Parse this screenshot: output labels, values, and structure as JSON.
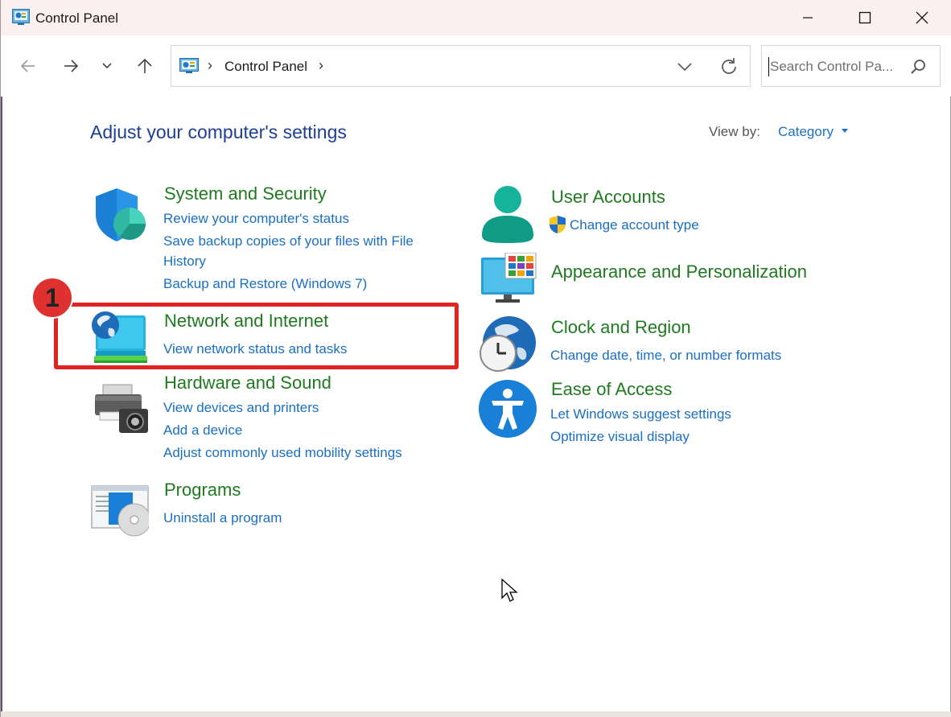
{
  "window": {
    "title": "Control Panel",
    "minimize_glyph": "—",
    "maximize_glyph": "☐",
    "close_glyph": "✕"
  },
  "navigation": {
    "back_icon": "arrow-left-icon",
    "forward_icon": "arrow-right-icon",
    "recent_icon": "chevron-down-icon",
    "up_icon": "arrow-up-icon"
  },
  "address_bar": {
    "separator": "›",
    "location": "Control Panel"
  },
  "search": {
    "placeholder": "Search Control Pa..."
  },
  "page": {
    "heading": "Adjust your computer's settings",
    "view_by_label": "View by:",
    "view_by_value": "Category"
  },
  "categories": {
    "system_security": {
      "title": "System and Security",
      "links": [
        "Review your computer's status",
        "Save backup copies of your files with File",
        "History",
        "Backup and Restore (Windows 7)"
      ]
    },
    "network_internet": {
      "title": "Network and Internet",
      "links": [
        "View network status and tasks"
      ]
    },
    "hardware_sound": {
      "title": "Hardware and Sound",
      "links": [
        "View devices and printers",
        "Add a device",
        "Adjust commonly used mobility settings"
      ]
    },
    "programs": {
      "title": "Programs",
      "links": [
        "Uninstall a program"
      ]
    },
    "user_accounts": {
      "title": "User Accounts",
      "links": [
        "Change account type"
      ]
    },
    "appearance": {
      "title": "Appearance and Personalization",
      "links": []
    },
    "clock_region": {
      "title": "Clock and Region",
      "links": [
        "Change date, time, or number formats"
      ]
    },
    "ease_access": {
      "title": "Ease of Access",
      "links": [
        "Let Windows suggest settings",
        "Optimize visual display"
      ]
    }
  },
  "annotation": {
    "step_number": "1",
    "highlight_color": "#e02424"
  },
  "colors": {
    "title_green": "#1f7a1f",
    "link_blue": "#1a6fc4",
    "heading_blue": "#1c3f94"
  }
}
